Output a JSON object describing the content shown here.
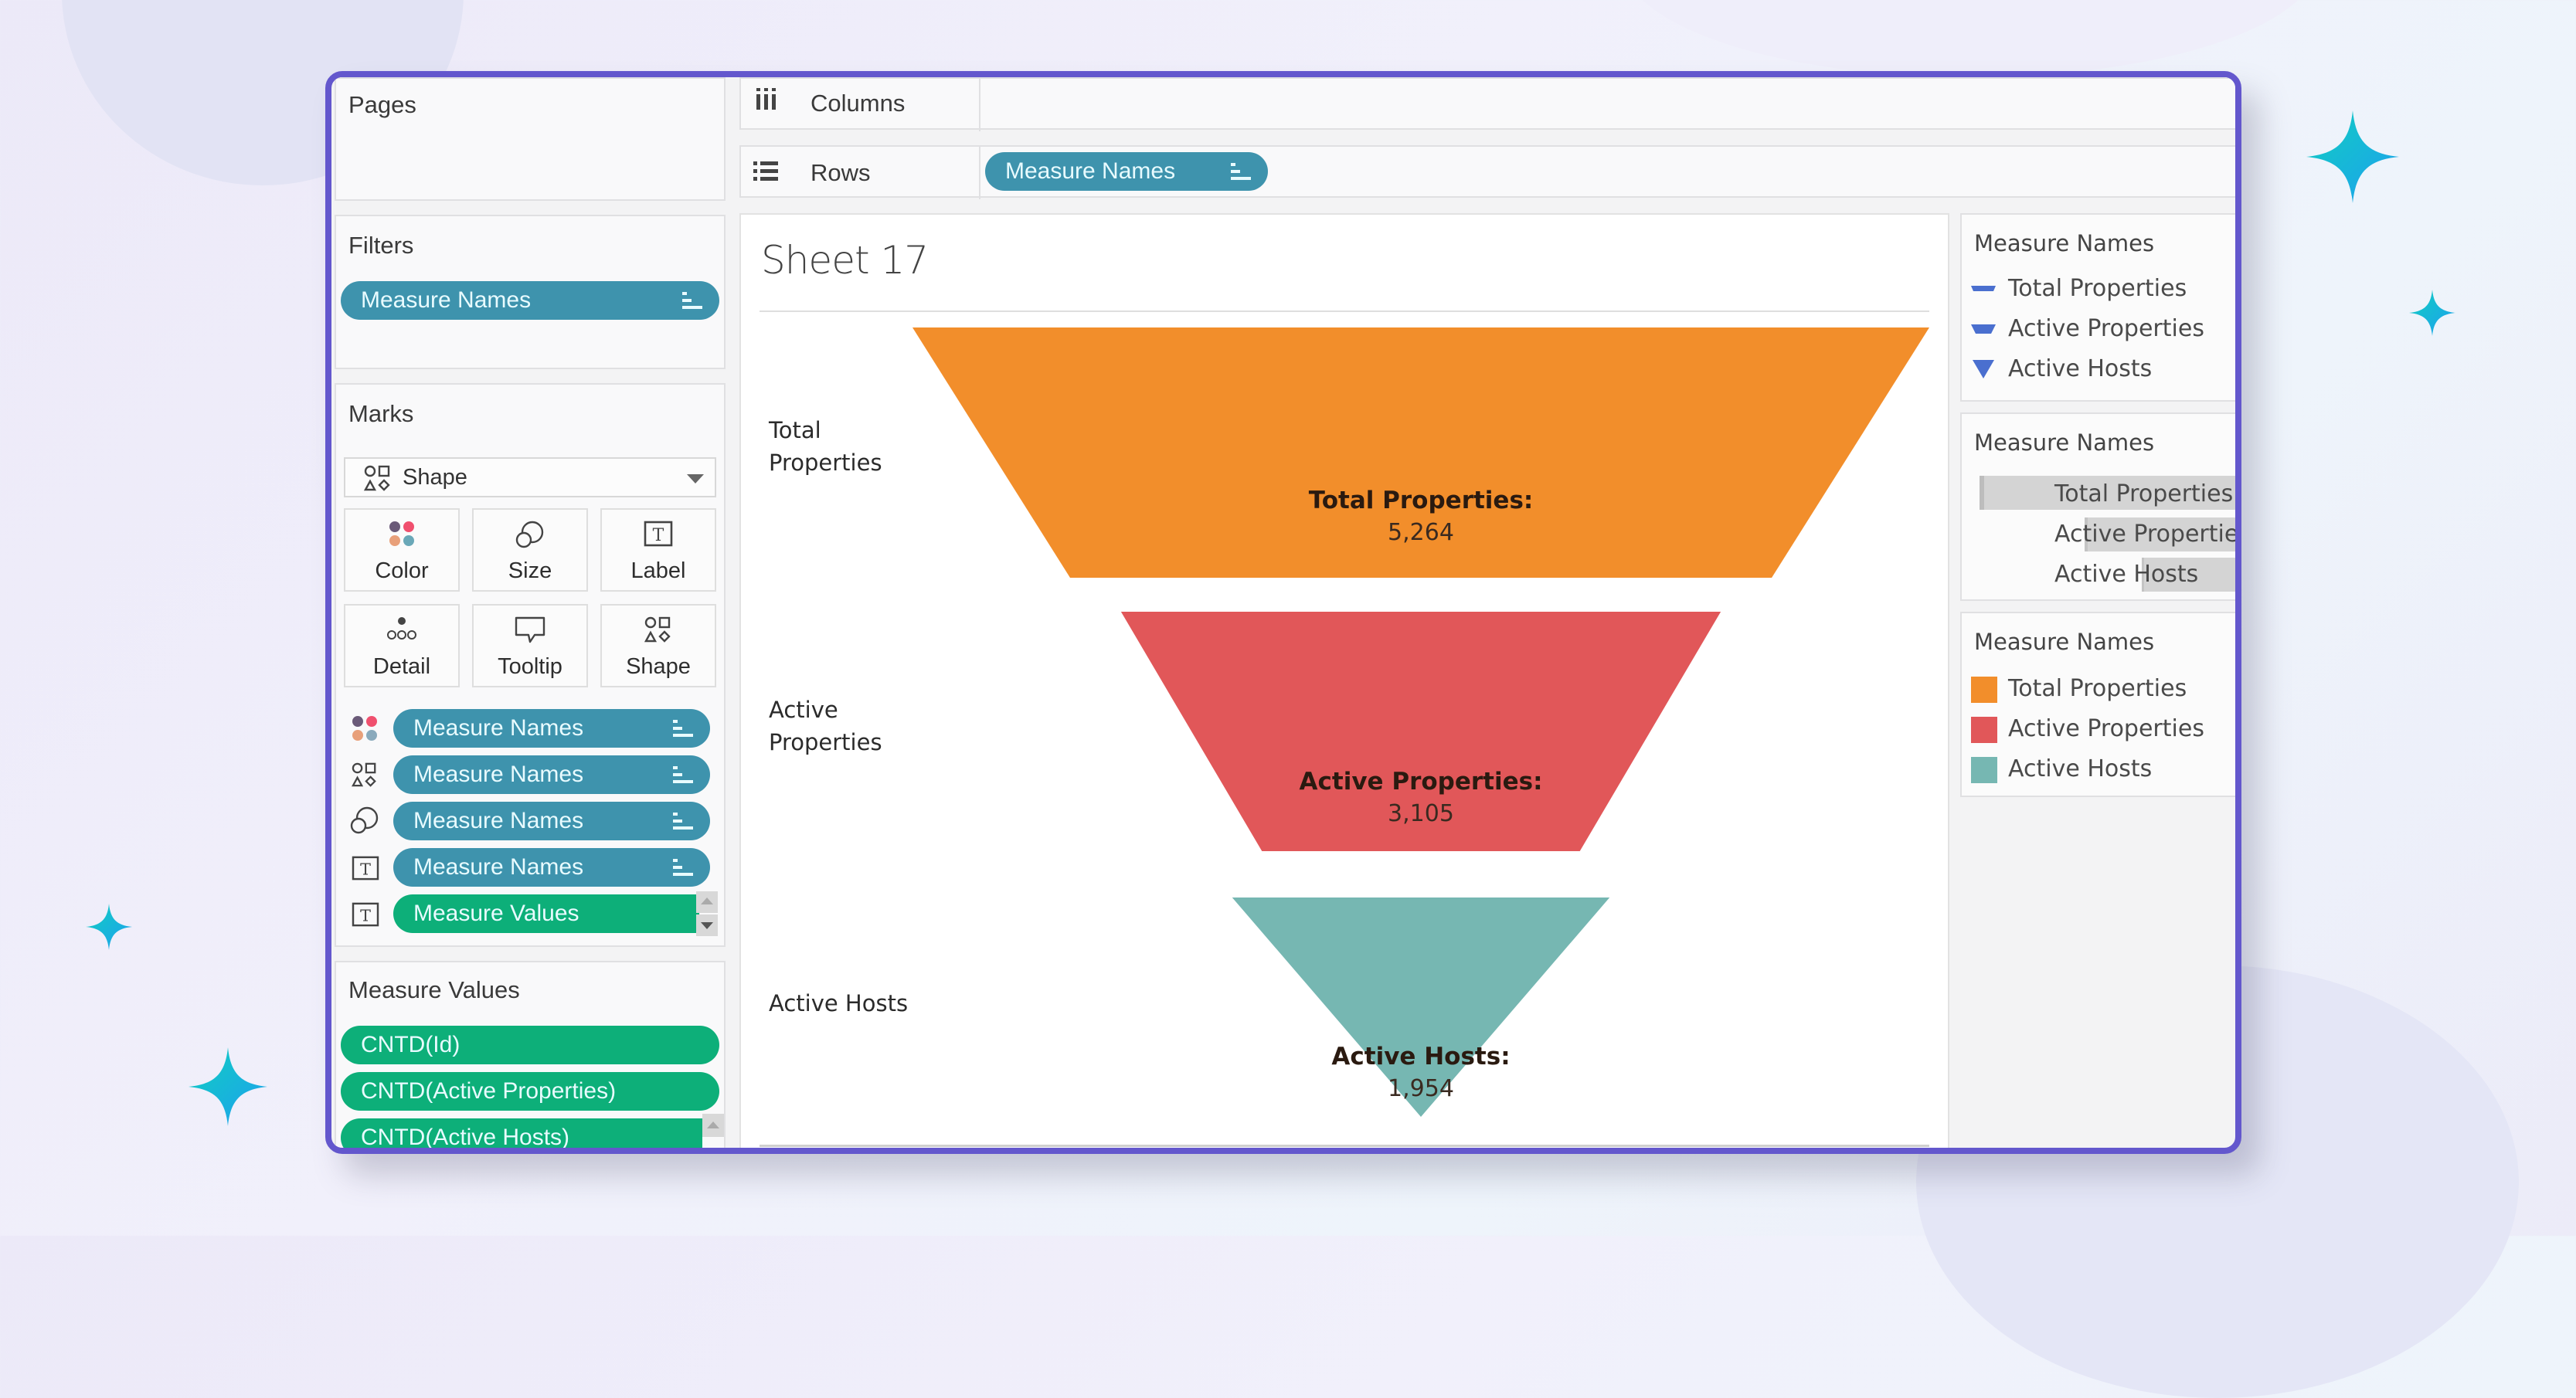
{
  "shelves": {
    "columns_label": "Columns",
    "rows_label": "Rows",
    "rows_pill": "Measure Names"
  },
  "pages": {
    "title": "Pages"
  },
  "filters": {
    "title": "Filters",
    "pill": "Measure Names"
  },
  "marks": {
    "title": "Marks",
    "mark_type": "Shape",
    "buttons": [
      {
        "label": "Color",
        "icon": "color-icon"
      },
      {
        "label": "Size",
        "icon": "size-icon"
      },
      {
        "label": "Label",
        "icon": "label-icon"
      },
      {
        "label": "Detail",
        "icon": "detail-icon"
      },
      {
        "label": "Tooltip",
        "icon": "tooltip-icon"
      },
      {
        "label": "Shape",
        "icon": "shape-icon"
      }
    ],
    "fields": [
      {
        "icon": "color-icon",
        "label": "Measure Names",
        "type": "dimension"
      },
      {
        "icon": "shape-icon",
        "label": "Measure Names",
        "type": "dimension"
      },
      {
        "icon": "size-icon",
        "label": "Measure Names",
        "type": "dimension"
      },
      {
        "icon": "label-icon",
        "label": "Measure Names",
        "type": "dimension"
      },
      {
        "icon": "label-icon",
        "label": "Measure Values",
        "type": "measure"
      }
    ]
  },
  "measure_values": {
    "title": "Measure Values",
    "pills": [
      "CNTD(Id)",
      "CNTD(Active Properties)",
      "CNTD(Active Hosts)"
    ]
  },
  "sheet": {
    "title": "Sheet 17"
  },
  "legends": [
    {
      "title": "Measure Names",
      "kind": "shape",
      "items": [
        "Total Properties",
        "Active Properties",
        "Active Hosts"
      ]
    },
    {
      "title": "Measure Names",
      "kind": "size",
      "items": [
        "Total Properties",
        "Active Properties",
        "Active Hosts"
      ],
      "relative_sizes": [
        1.0,
        0.59,
        0.37
      ]
    },
    {
      "title": "Measure Names",
      "kind": "color",
      "items": [
        "Total Properties",
        "Active Properties",
        "Active Hosts"
      ],
      "colors": [
        "#f28e2b",
        "#e15759",
        "#76b7b2"
      ]
    }
  ],
  "colors": {
    "frame": "#6357cd",
    "pill_dimension": "#3e93ad",
    "pill_measure": "#0daf79",
    "shape_legend": "#4a6fcf",
    "sparkle": "#1db8d8"
  },
  "chart_data": {
    "type": "funnel",
    "title": "Sheet 17",
    "categories": [
      "Total Properties",
      "Active Properties",
      "Active Hosts"
    ],
    "row_labels": [
      "Total\nProperties",
      "Active\nProperties",
      "Active Hosts"
    ],
    "values": [
      5264,
      3105,
      1954
    ],
    "value_labels": [
      "5,264",
      "3,105",
      "1,954"
    ],
    "label_titles": [
      "Total Properties:",
      "Active Properties:",
      "Active Hosts:"
    ],
    "colors": [
      "#f28e2b",
      "#e15759",
      "#76b7b2"
    ],
    "legend": "right"
  }
}
